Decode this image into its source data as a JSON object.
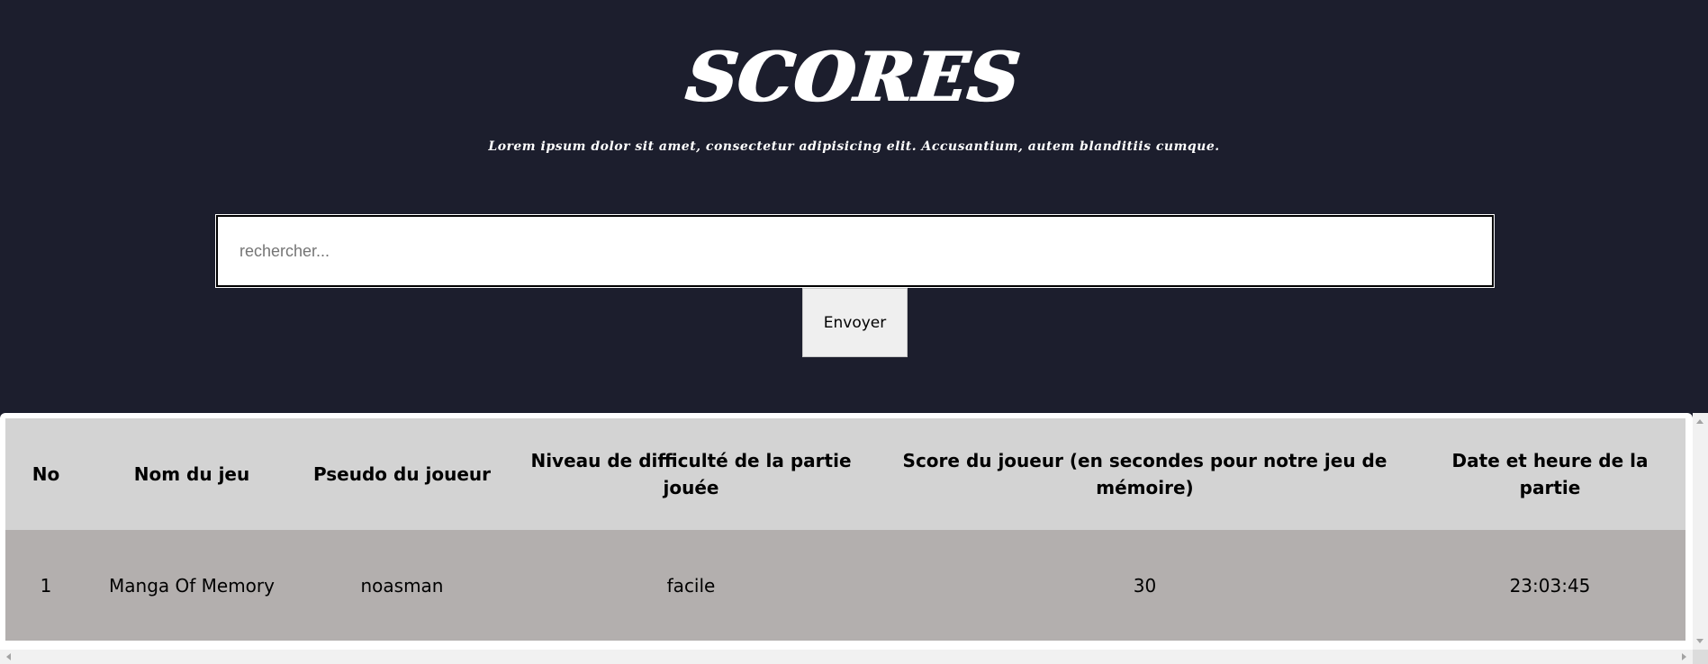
{
  "header": {
    "title": "SCORES",
    "subtitle": "Lorem ipsum dolor sit amet, consectetur adipisicing elit. Accusantium, autem blanditiis cumque."
  },
  "search": {
    "placeholder": "rechercher...",
    "value": "",
    "button_label": "Envoyer"
  },
  "table": {
    "columns": [
      "No",
      "Nom du jeu",
      "Pseudo du joueur",
      "Niveau de difficulté de la partie jouée",
      "Score du joueur (en secondes pour notre jeu de mémoire)",
      "Date et heure de la partie"
    ],
    "rows": [
      [
        "1",
        "Manga Of Memory",
        "noasman",
        "facile",
        "30",
        "23:03:45"
      ]
    ]
  },
  "colors": {
    "background": "#1c1e2d",
    "header_row": "#d3d3d3",
    "data_row": "#b3afae",
    "title_text": "#ffffff"
  },
  "icons": {
    "scroll_up": "triangle-up-icon",
    "scroll_down": "triangle-down-icon",
    "scroll_left": "triangle-left-icon",
    "scroll_right": "triangle-right-icon"
  }
}
